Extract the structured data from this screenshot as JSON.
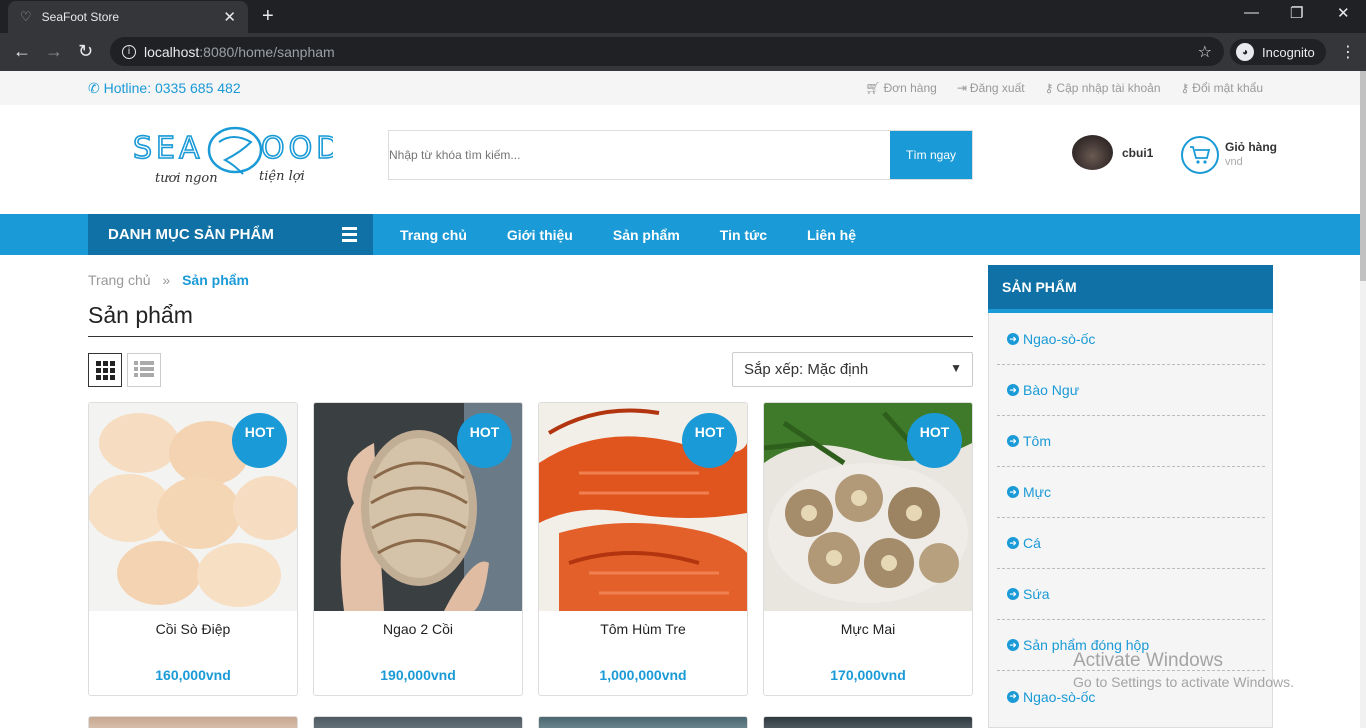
{
  "browser": {
    "tab_title": "SeaFoot Store",
    "url_host": "localhost",
    "url_path": ":8080/home/sanpham",
    "incognito_label": "Incognito"
  },
  "topbar": {
    "hotline": "Hotline: 0335 685 482",
    "links": [
      "Đơn hàng",
      "Đăng xuất",
      "Cập nhập tài khoản",
      "Đổi mật khẩu"
    ]
  },
  "header": {
    "logo_text_1": "SEA",
    "logo_text_2": "OOD",
    "logo_tagline_1": "tươi ngon",
    "logo_tagline_2": "tiện lợi",
    "search_placeholder": "Nhập từ khóa tìm kiếm...",
    "search_button": "Tìm ngay",
    "username": "cbui1",
    "cart_label": "Giỏ hàng",
    "cart_currency": "vnd"
  },
  "nav": {
    "category_label": "DANH MỤC SẢN PHẨM",
    "items": [
      "Trang chủ",
      "Giới thiệu",
      "Sản phẩm",
      "Tin tức",
      "Liên hệ"
    ]
  },
  "breadcrumb": {
    "home": "Trang chủ",
    "separator": "»",
    "current": "Sản phẩm"
  },
  "main": {
    "title": "Sản phẩm",
    "sort_label": "Sắp xếp:  Mặc định"
  },
  "products": [
    {
      "name": "Cồi Sò Điệp",
      "price": "160,000vnd",
      "badge": "HOT"
    },
    {
      "name": "Ngao 2 Cồi",
      "price": "190,000vnd",
      "badge": "HOT"
    },
    {
      "name": "Tôm Hùm Tre",
      "price": "1,000,000vnd",
      "badge": "HOT"
    },
    {
      "name": "Mực Mai",
      "price": "170,000vnd",
      "badge": "HOT"
    }
  ],
  "sidebar": {
    "title": "SẢN PHẨM",
    "items": [
      "Ngao-sò-ốc",
      "Bào Ngư",
      "Tôm",
      "Mực",
      "Cá",
      "Sứa",
      "Sản phẩm đóng hộp",
      "Ngao-sò-ốc"
    ]
  },
  "watermark": {
    "line1": "Activate Windows",
    "line2": "Go to Settings to activate Windows."
  },
  "colors": {
    "primary": "#1a9ad6",
    "primary_dark": "#0f71a5"
  }
}
